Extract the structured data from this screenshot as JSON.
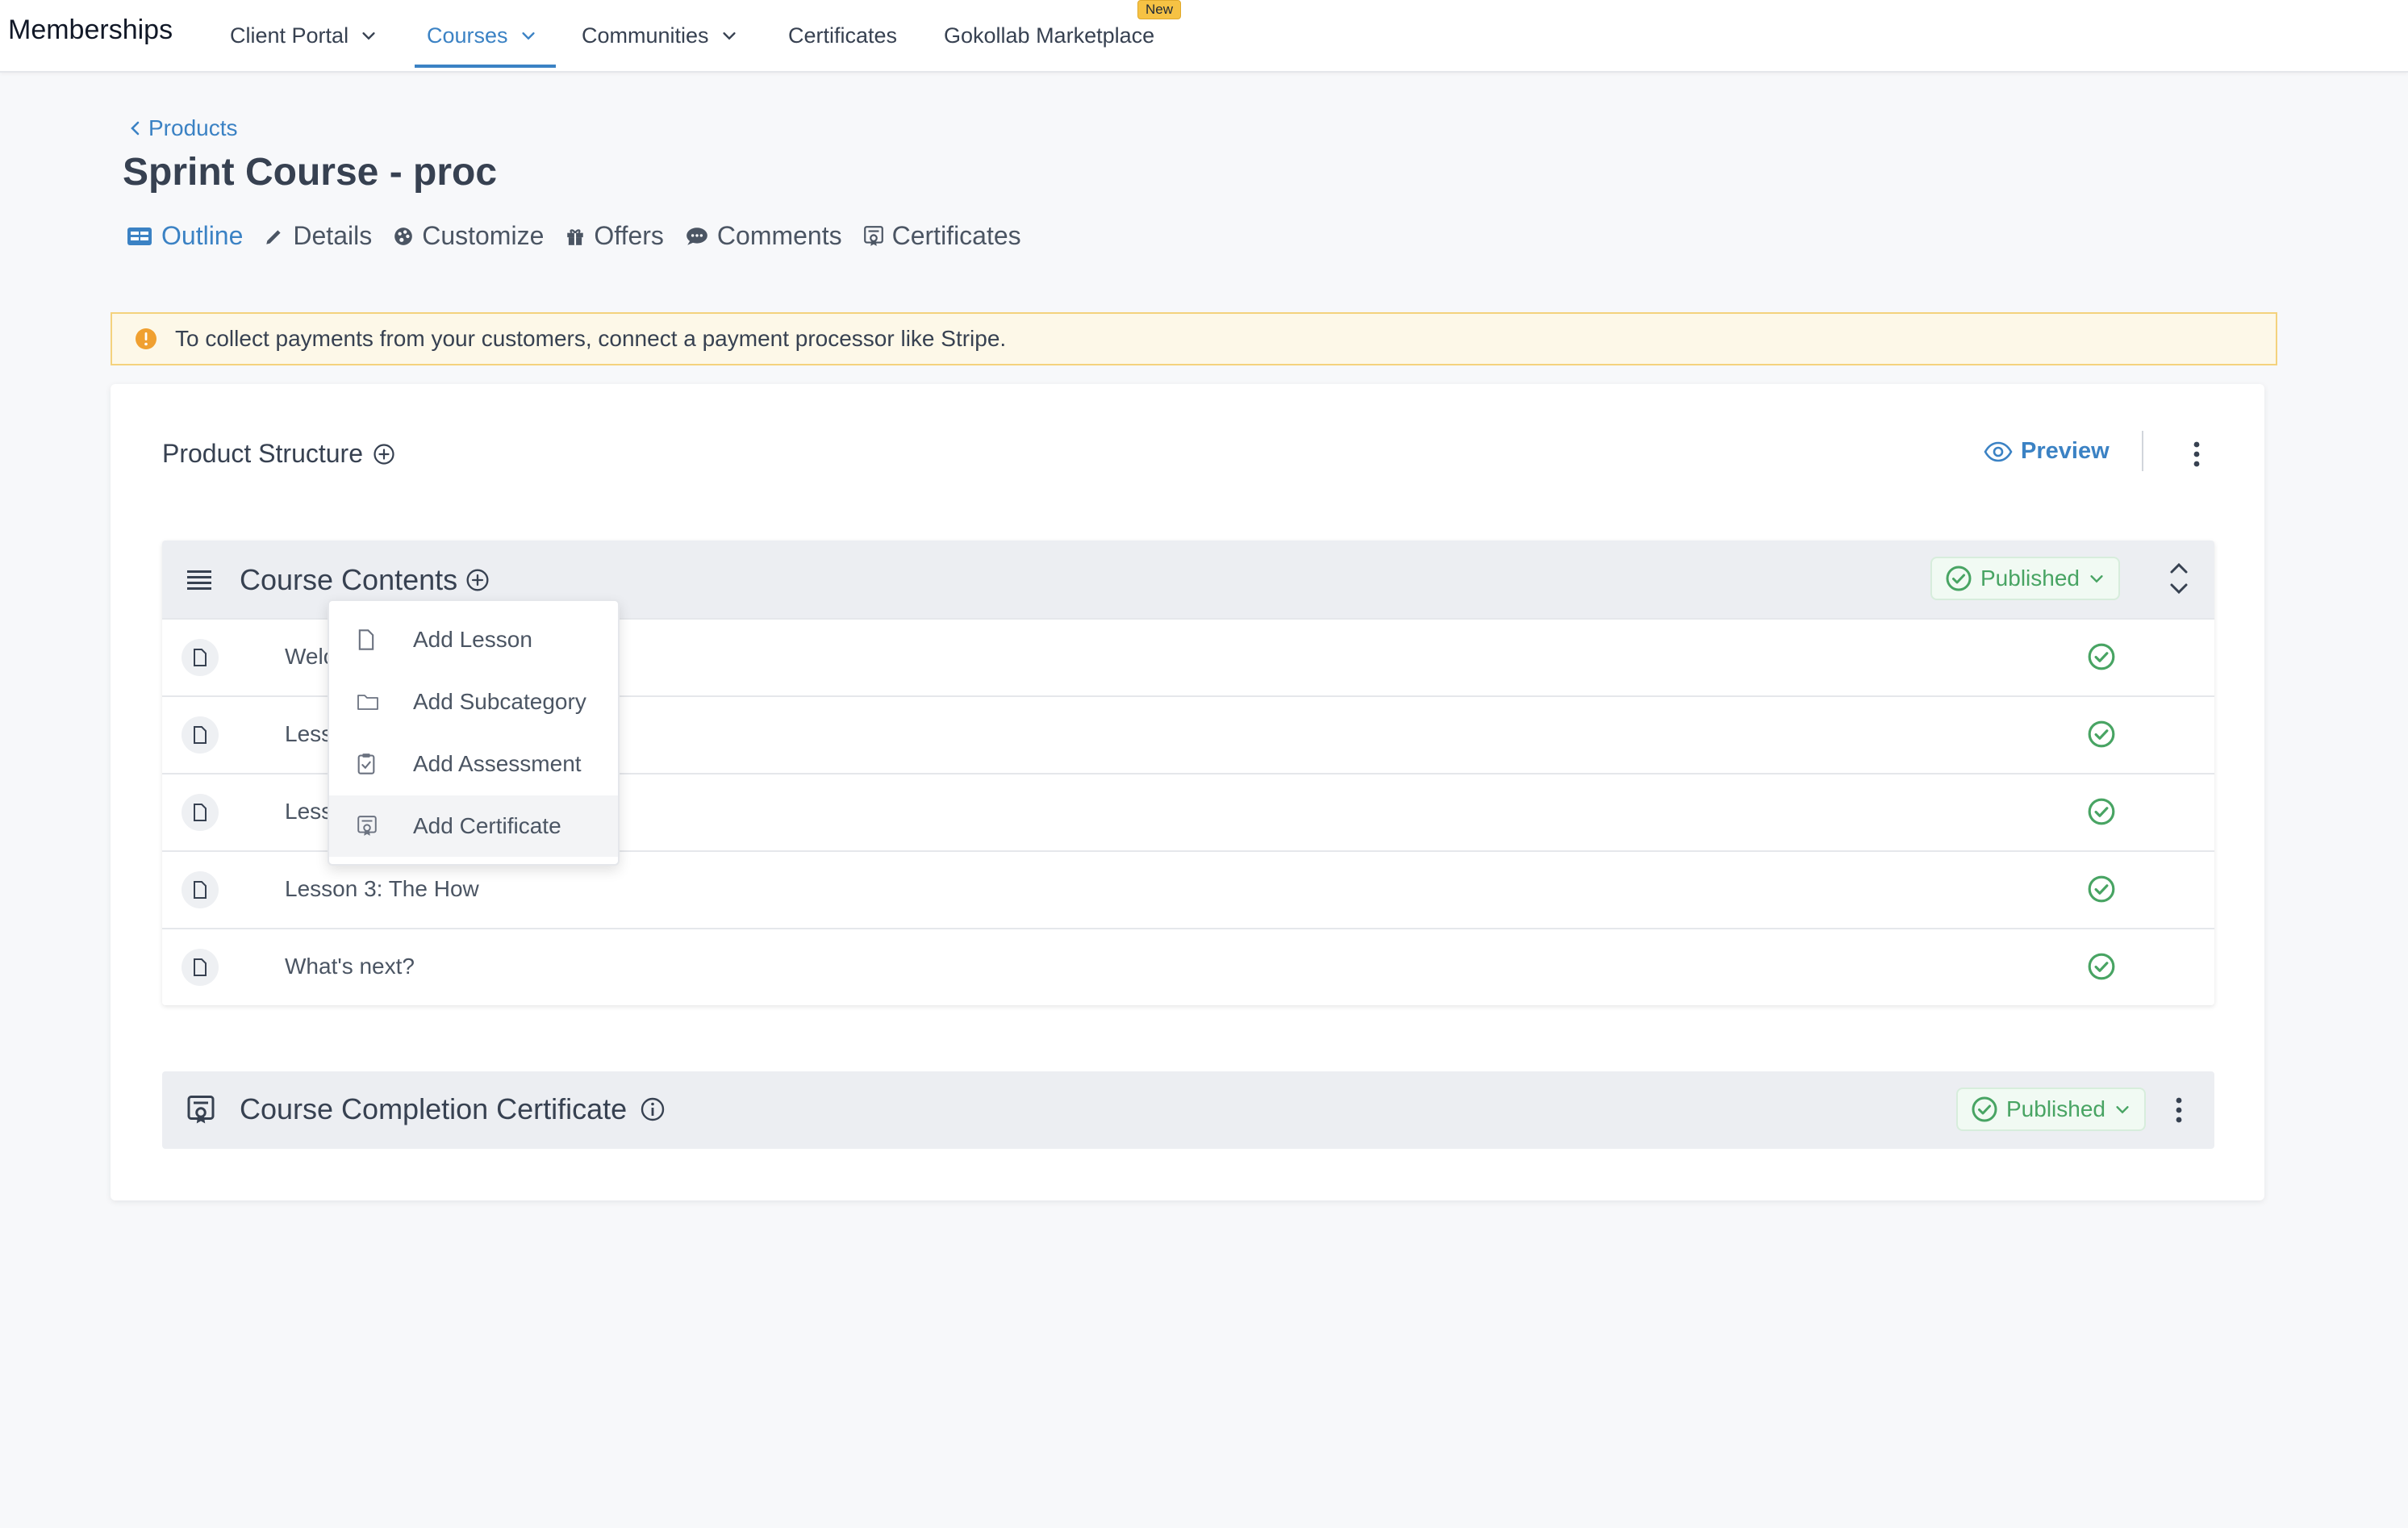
{
  "nav": {
    "brand": "Memberships",
    "items": [
      {
        "label": "Client Portal"
      },
      {
        "label": "Courses"
      },
      {
        "label": "Communities"
      },
      {
        "label": "Certificates"
      },
      {
        "label": "Gokollab Marketplace",
        "badge": "New"
      }
    ],
    "active": "Courses"
  },
  "breadcrumb": "Products",
  "page_title": "Sprint Course - proc",
  "tabs": [
    {
      "label": "Outline",
      "icon": "outline-icon",
      "active": true
    },
    {
      "label": "Details",
      "icon": "pencil-icon"
    },
    {
      "label": "Customize",
      "icon": "palette-icon"
    },
    {
      "label": "Offers",
      "icon": "gift-icon"
    },
    {
      "label": "Comments",
      "icon": "comment-icon"
    },
    {
      "label": "Certificates",
      "icon": "certificate-icon"
    }
  ],
  "alert": {
    "text": "To collect payments from your customers, connect a payment processor like Stripe.",
    "icon": "warning-icon",
    "color": "#f0a030"
  },
  "product_structure": {
    "title": "Product Structure",
    "preview_label": "Preview"
  },
  "course_contents": {
    "title": "Course Contents",
    "status": "Published",
    "rows": [
      {
        "title": "Welc",
        "status": "published"
      },
      {
        "title": "Less",
        "status": "published"
      },
      {
        "title": "Less",
        "status": "published"
      },
      {
        "title": "Lesson 3: The How",
        "status": "published"
      },
      {
        "title": "What's next?",
        "status": "published"
      }
    ]
  },
  "add_menu": {
    "items": [
      {
        "label": "Add Lesson",
        "icon": "document-icon"
      },
      {
        "label": "Add Subcategory",
        "icon": "folder-icon"
      },
      {
        "label": "Add Assessment",
        "icon": "clipboard-check-icon"
      },
      {
        "label": "Add Certificate",
        "icon": "certificate-icon",
        "hovered": true
      }
    ]
  },
  "certificate_section": {
    "title": "Course Completion Certificate",
    "status": "Published"
  },
  "colors": {
    "accent": "#3b82c4",
    "published_green": "#48a463",
    "badge_yellow": "#f6c244"
  }
}
